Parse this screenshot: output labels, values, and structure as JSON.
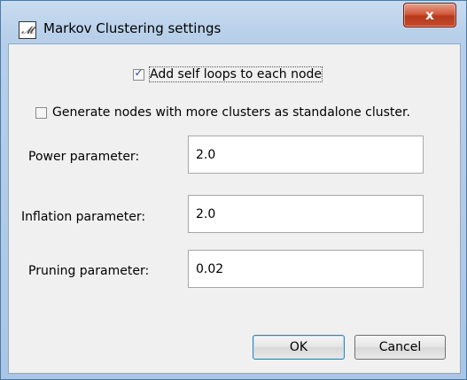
{
  "window": {
    "title": "Markov Clustering settings",
    "close_label": "x"
  },
  "options": {
    "self_loops": {
      "label": "Add self loops to each node",
      "checked": true
    },
    "standalone": {
      "label": "Generate nodes with more clusters as standalone cluster.",
      "checked": false
    }
  },
  "fields": {
    "power": {
      "label": "Power parameter:",
      "value": "2.0"
    },
    "inflation": {
      "label": "Inflation parameter:",
      "value": "2.0"
    },
    "pruning": {
      "label": "Pruning parameter:",
      "value": "0.02"
    }
  },
  "buttons": {
    "ok": "OK",
    "cancel": "Cancel"
  },
  "colors": {
    "titlebar": "#b7cfe9",
    "close_button": "#c24a2c",
    "dialog_bg": "#f0f0f0"
  },
  "icons": {
    "app": "app-icon",
    "close": "close-icon",
    "check": "check-icon"
  }
}
